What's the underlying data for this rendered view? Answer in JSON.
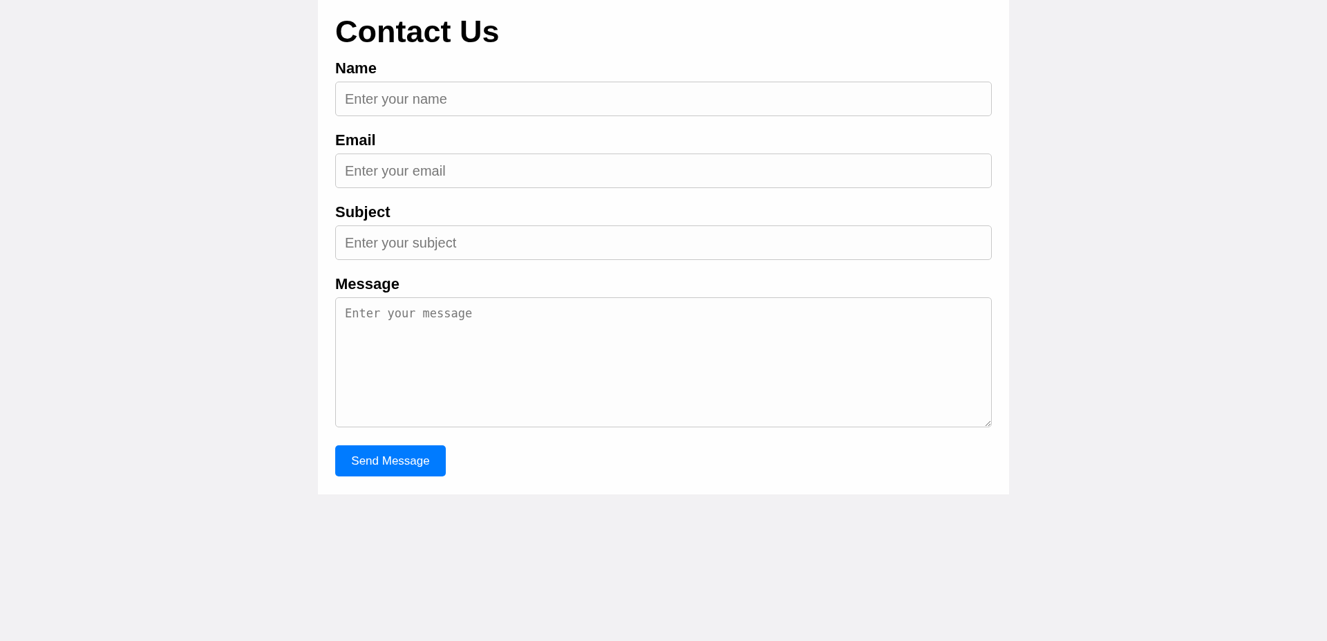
{
  "title": "Contact Us",
  "fields": [
    {
      "kind": "input",
      "label": "Name",
      "placeholder": "Enter your name"
    },
    {
      "kind": "input",
      "label": "Email",
      "placeholder": "Enter your email"
    },
    {
      "kind": "input",
      "label": "Subject",
      "placeholder": "Enter your subject"
    },
    {
      "kind": "textarea",
      "label": "Message",
      "placeholder": "Enter your message"
    }
  ],
  "submit": "Send Message"
}
